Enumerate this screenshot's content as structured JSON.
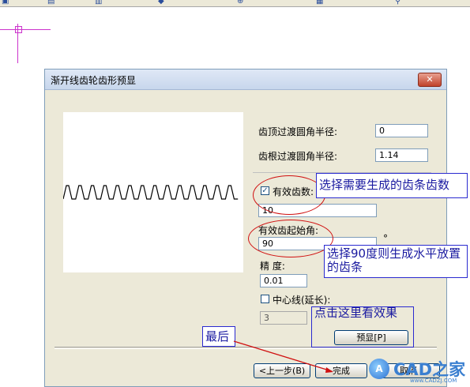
{
  "dialog": {
    "title": "渐开线齿轮齿形预显",
    "close_icon": "close-icon"
  },
  "form": {
    "tip_fillet_label": "齿顶过渡圆角半径:",
    "tip_fillet_value": "0",
    "root_fillet_label": "齿根过渡圆角半径:",
    "root_fillet_value": "1.14",
    "effective_teeth_label": "有效齿数:",
    "effective_teeth_checked": true,
    "effective_teeth_value": "10",
    "start_angle_label": "有效齿起始角:",
    "start_angle_value": "90",
    "start_angle_unit": "°",
    "precision_label": "精    度:",
    "precision_value": "0.01",
    "centerline_label": "中心线(延长):",
    "centerline_checked": false,
    "centerline_value": "3"
  },
  "buttons": {
    "preview": "预显[P]",
    "back": "<上一步(B)",
    "finish": "完成",
    "cancel": "取消"
  },
  "annotations": {
    "select_teeth": "选择需要生成的齿条齿数",
    "select_90": "选择90度则生成水平放置的齿条",
    "click_here": "点击这里看效果",
    "last": "最后"
  },
  "watermark": {
    "brand": "CAD之家",
    "url": "www.CADZJ.COM",
    "logo": "A"
  }
}
